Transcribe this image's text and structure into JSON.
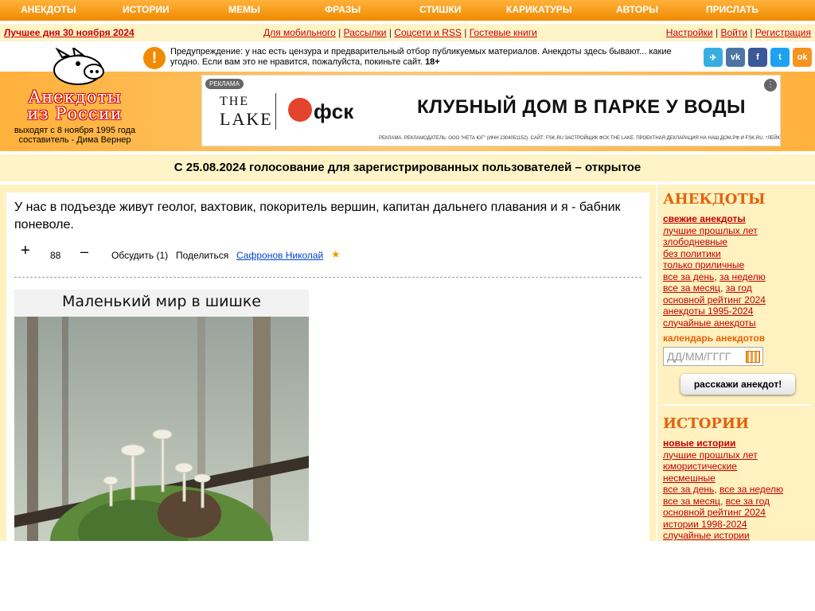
{
  "nav": {
    "items": [
      "АНЕКДОТЫ",
      "ИСТОРИИ",
      "МЕМЫ",
      "ФРАЗЫ",
      "СТИШКИ",
      "КАРИКАТУРЫ",
      "АВТОРЫ",
      "ПРИСЛАТЬ"
    ]
  },
  "subbar": {
    "best_of_day": "Лучшее дня 30 ноября 2024",
    "center_links": [
      "Для мобильного",
      "Рассылки",
      "Соцсети и RSS",
      "Гостевые книги"
    ],
    "right_links": [
      "Настройки",
      "Войти",
      "Регистрация"
    ],
    "separator": "|"
  },
  "warning": {
    "icon": "!",
    "text": "Предупреждение: у нас есть цензура и предварительный отбор публикуемых материалов. Анекдоты здесь бывают... какие угодно. Если вам это не нравится, пожалуйста, покиньте сайт.",
    "age": "18+"
  },
  "social": [
    {
      "icon": "telegram-icon",
      "glyph": "✈",
      "color": "#37aee2"
    },
    {
      "icon": "vk-icon",
      "glyph": "vk",
      "color": "#4c75a3"
    },
    {
      "icon": "facebook-icon",
      "glyph": "f",
      "color": "#3b5998"
    },
    {
      "icon": "twitter-icon",
      "glyph": "t",
      "color": "#1da1f2"
    },
    {
      "icon": "odnoklassniki-icon",
      "glyph": "ok",
      "color": "#f7931e"
    }
  ],
  "logo": {
    "title_line1": "Анекдоты",
    "title_line2": "из России",
    "subtitle_line1": "выходят с 8 ноября 1995 года",
    "subtitle_line2": "составитель - Дима Вернер"
  },
  "ad": {
    "tag": "РЕКЛАМА",
    "menu": "⋮",
    "brand1_line1": "THE",
    "brand1_line2": "LAKE",
    "brand2": "фск",
    "headline": "КЛУБНЫЙ ДОМ В ПАРКЕ У ВОДЫ",
    "legal": "РЕКЛАМА. РЕКЛАМОДАТЕЛЬ: ООО \"НЕТА ЮГ\" (ИНН 2304051152). САЙТ: FSK.RU ЗАСТРОЙЩИК ФСК THE LAKE. ПРОЕКТНАЯ ДЕКЛАРАЦИЯ НА НАШ.ДОМ.РФ И FSK.RU. *ЛЕЙК"
  },
  "notice": "С 25.08.2024 голосование для зарегистрированных пользователей – открытое",
  "joke": {
    "text": "У нас в подъезде живут геолог, вахтовик, покоритель вершин, капитан дальнего плавания и я - бабник поневоле.",
    "plus": "+",
    "rating": "88",
    "minus": "–",
    "discuss": "Обсудить (1)",
    "share": "Поделиться",
    "author": "Сафронов Николай",
    "star": "★"
  },
  "meme": {
    "title": "Маленький мир в шишке"
  },
  "sidebar": {
    "anekdoty": {
      "heading": "АНЕКДОТЫ",
      "fresh": "свежие анекдоты",
      "links": [
        "лучшие прошлых лет",
        "злободневные",
        "без политики",
        "только приличные"
      ],
      "pair1": [
        "все за день",
        "за неделю"
      ],
      "pair2": [
        "все за месяц",
        "за год"
      ],
      "links2": [
        "основной рейтинг 2024",
        "анекдоты 1995-2024",
        "случайные анекдоты"
      ],
      "calendar_label": "календарь анекдотов",
      "calendar_placeholder": "ДД/ММ/ГГГГ",
      "tell_button": "расскажи анекдот!"
    },
    "istorii": {
      "heading": "ИСТОРИИ",
      "fresh": "новые истории",
      "links": [
        "лучшие прошлых лет",
        "юмористические",
        "несмешные"
      ],
      "pair1": [
        "все за день",
        "все за неделю"
      ],
      "pair2": [
        "все за месяц",
        "все за год"
      ],
      "links2": [
        "основной рейтинг 2024",
        "истории 1998-2024",
        "случайные истории"
      ]
    }
  }
}
